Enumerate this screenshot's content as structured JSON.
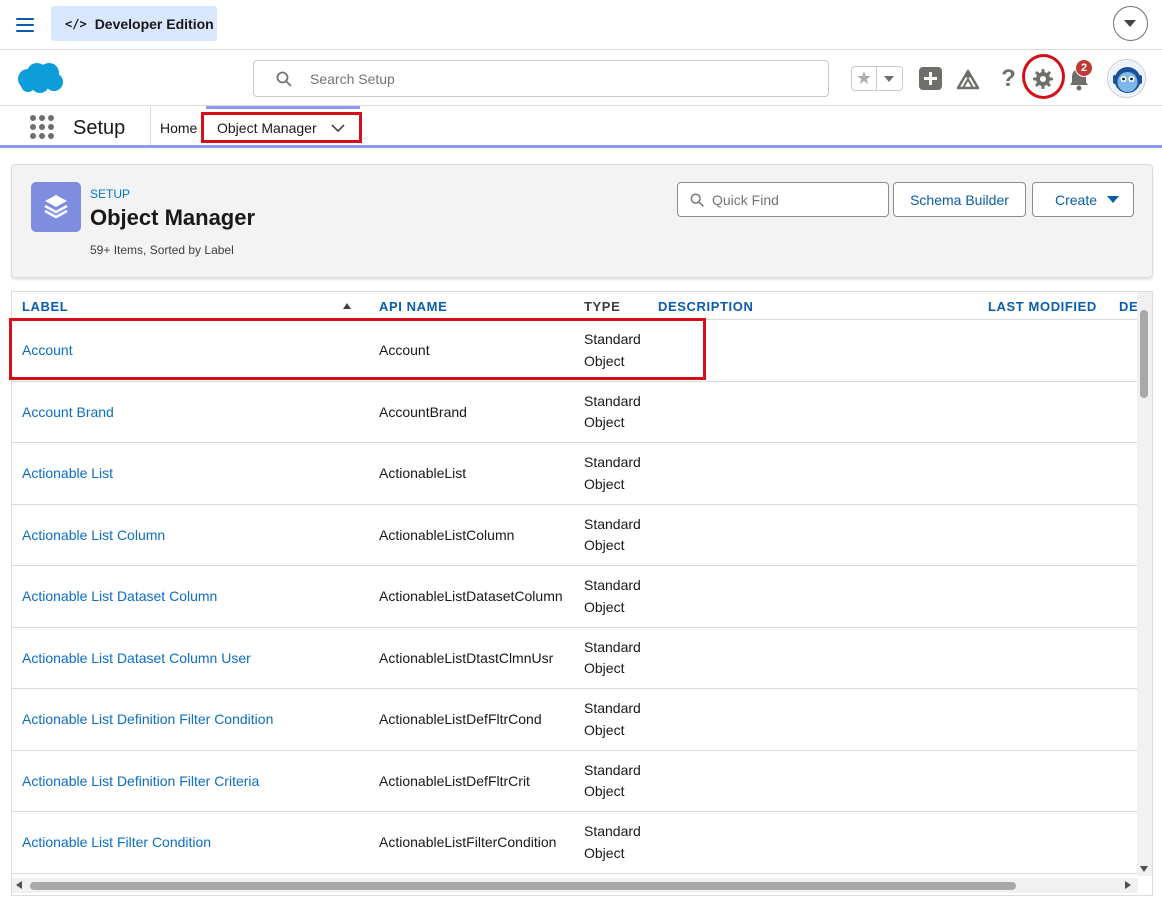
{
  "topbar": {
    "edition_code": "</>",
    "edition_label": "Developer Edition"
  },
  "header": {
    "search_placeholder": "Search Setup",
    "notification_count": "2",
    "icons": [
      "salesforce-cloud-icon",
      "search-icon",
      "star-icon",
      "plus-icon",
      "trailhead-icon",
      "help-icon",
      "gear-icon",
      "bell-icon",
      "avatar"
    ]
  },
  "nav": {
    "app_name": "Setup",
    "home_label": "Home",
    "active_tab_label": "Object Manager"
  },
  "page": {
    "eyebrow": "SETUP",
    "title": "Object Manager",
    "subtitle": "59+ Items, Sorted by Label",
    "quick_find_placeholder": "Quick Find",
    "schema_builder_label": "Schema Builder",
    "create_label": "Create"
  },
  "table": {
    "columns": [
      "LABEL",
      "API NAME",
      "TYPE",
      "DESCRIPTION",
      "LAST MODIFIED",
      "DE"
    ],
    "rows": [
      {
        "label": "Account",
        "api": "Account",
        "type": "Standard Object"
      },
      {
        "label": "Account Brand",
        "api": "AccountBrand",
        "type": "Standard Object"
      },
      {
        "label": "Actionable List",
        "api": "ActionableList",
        "type": "Standard Object"
      },
      {
        "label": "Actionable List Column",
        "api": "ActionableListColumn",
        "type": "Standard Object"
      },
      {
        "label": "Actionable List Dataset Column",
        "api": "ActionableListDatasetColumn",
        "type": "Standard Object"
      },
      {
        "label": "Actionable List Dataset Column User",
        "api": "ActionableListDtastClmnUsr",
        "type": "Standard Object"
      },
      {
        "label": "Actionable List Definition Filter Condition",
        "api": "ActionableListDefFltrCond",
        "type": "Standard Object"
      },
      {
        "label": "Actionable List Definition Filter Criteria",
        "api": "ActionableListDefFltrCrit",
        "type": "Standard Object"
      },
      {
        "label": "Actionable List Filter Condition",
        "api": "ActionableListFilterCondition",
        "type": "Standard Object"
      }
    ]
  },
  "colors": {
    "brand_blue": "#0b5cab",
    "link_blue": "#0b6dc4",
    "highlight_red": "#d40f1a",
    "nav_accent": "#8b9bf2"
  }
}
